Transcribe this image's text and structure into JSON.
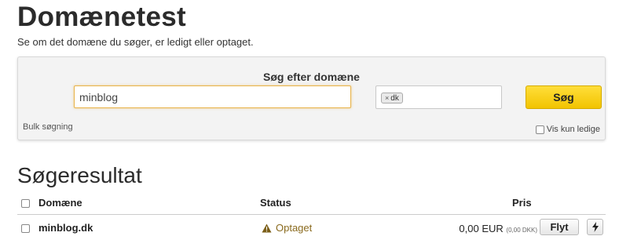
{
  "header": {
    "title": "Domænetest",
    "subtitle": "Se om det domæne du søger, er ledigt eller optaget."
  },
  "search": {
    "heading": "Søg efter domæne",
    "input_value": "minblog",
    "tld_tag": "dk",
    "tld_remove": "×",
    "button_label": "Søg",
    "bulk_link": "Bulk søgning",
    "only_free_label": "Vis kun ledige"
  },
  "results": {
    "title": "Søgeresultat",
    "columns": {
      "domain": "Domæne",
      "status": "Status",
      "price": "Pris"
    },
    "rows": [
      {
        "domain": "minblog.dk",
        "status": "Optaget",
        "status_icon": "warning-icon",
        "price": "0,00 EUR",
        "price_sub": "(0,00 DKK)",
        "move_label": "Flyt",
        "action_icon": "lightning-icon"
      }
    ]
  },
  "colors": {
    "accent": "#f2c400",
    "status_taken": "#8a6a1e",
    "input_focus": "#e8b34a"
  }
}
